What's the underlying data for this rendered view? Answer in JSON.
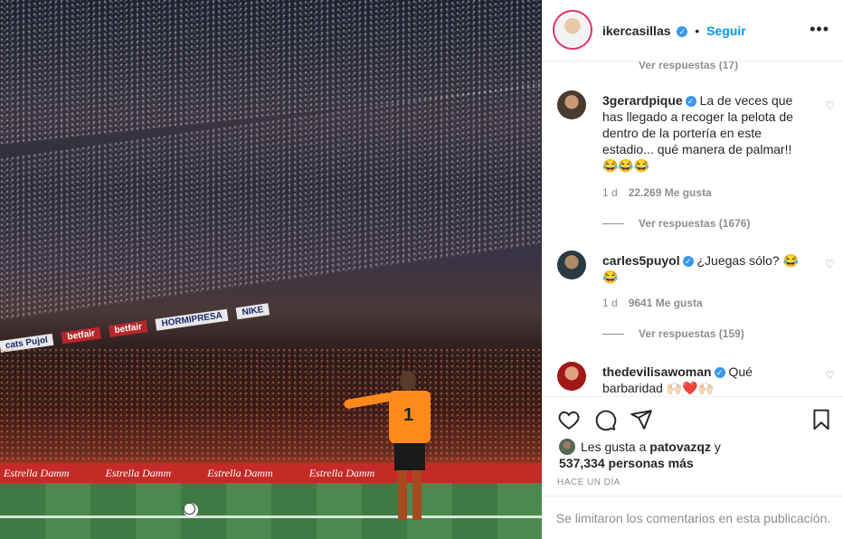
{
  "post": {
    "username": "ikercasillas",
    "follow_label": "Seguir",
    "separator": "•",
    "verified_mark": "✓",
    "more_label": "•••"
  },
  "photo": {
    "ads_upper": [
      "cats Pujol",
      "betfair",
      "betfair",
      "HORMIPRESA",
      "NIKE"
    ],
    "ads_board": [
      "Estrella Damm",
      "Estrella Damm",
      "Estrella Damm",
      "Estrella Damm"
    ],
    "keeper_number": "1"
  },
  "comments": {
    "top_replies": "Ver respuestas (17)",
    "items": [
      {
        "username": "3gerardpique",
        "text": "La de veces que has llegado a recoger la pelota de dentro de la portería en este estadio... qué manera de palmar!! 😂😂😂",
        "time": "1 d",
        "likes": "22.269 Me gusta",
        "replies": "Ver respuestas (1676)"
      },
      {
        "username": "carles5puyol",
        "text": "¿Juegas sólo? 😂😂",
        "time": "1 d",
        "likes": "9641 Me gusta",
        "replies": "Ver respuestas (159)"
      },
      {
        "username": "thedevilisawoman",
        "text": "Qué barbaridad 🙌🏻❤️🙌🏻"
      }
    ]
  },
  "likes": {
    "prefix": "Les gusta a",
    "user": "patovazqz",
    "connector": "y",
    "others": "537,334 personas más"
  },
  "time_ago": "HACE UN DÍA",
  "footer": "Se limitaron los comentarios en esta publicación.",
  "icons": [
    "heart-icon",
    "comment-icon",
    "share-icon",
    "bookmark-icon",
    "more-icon",
    "verified-icon"
  ],
  "colors": {
    "link": "#0095f6",
    "verified": "#3897f0",
    "muted": "#8e8e8e",
    "text": "#262626"
  }
}
